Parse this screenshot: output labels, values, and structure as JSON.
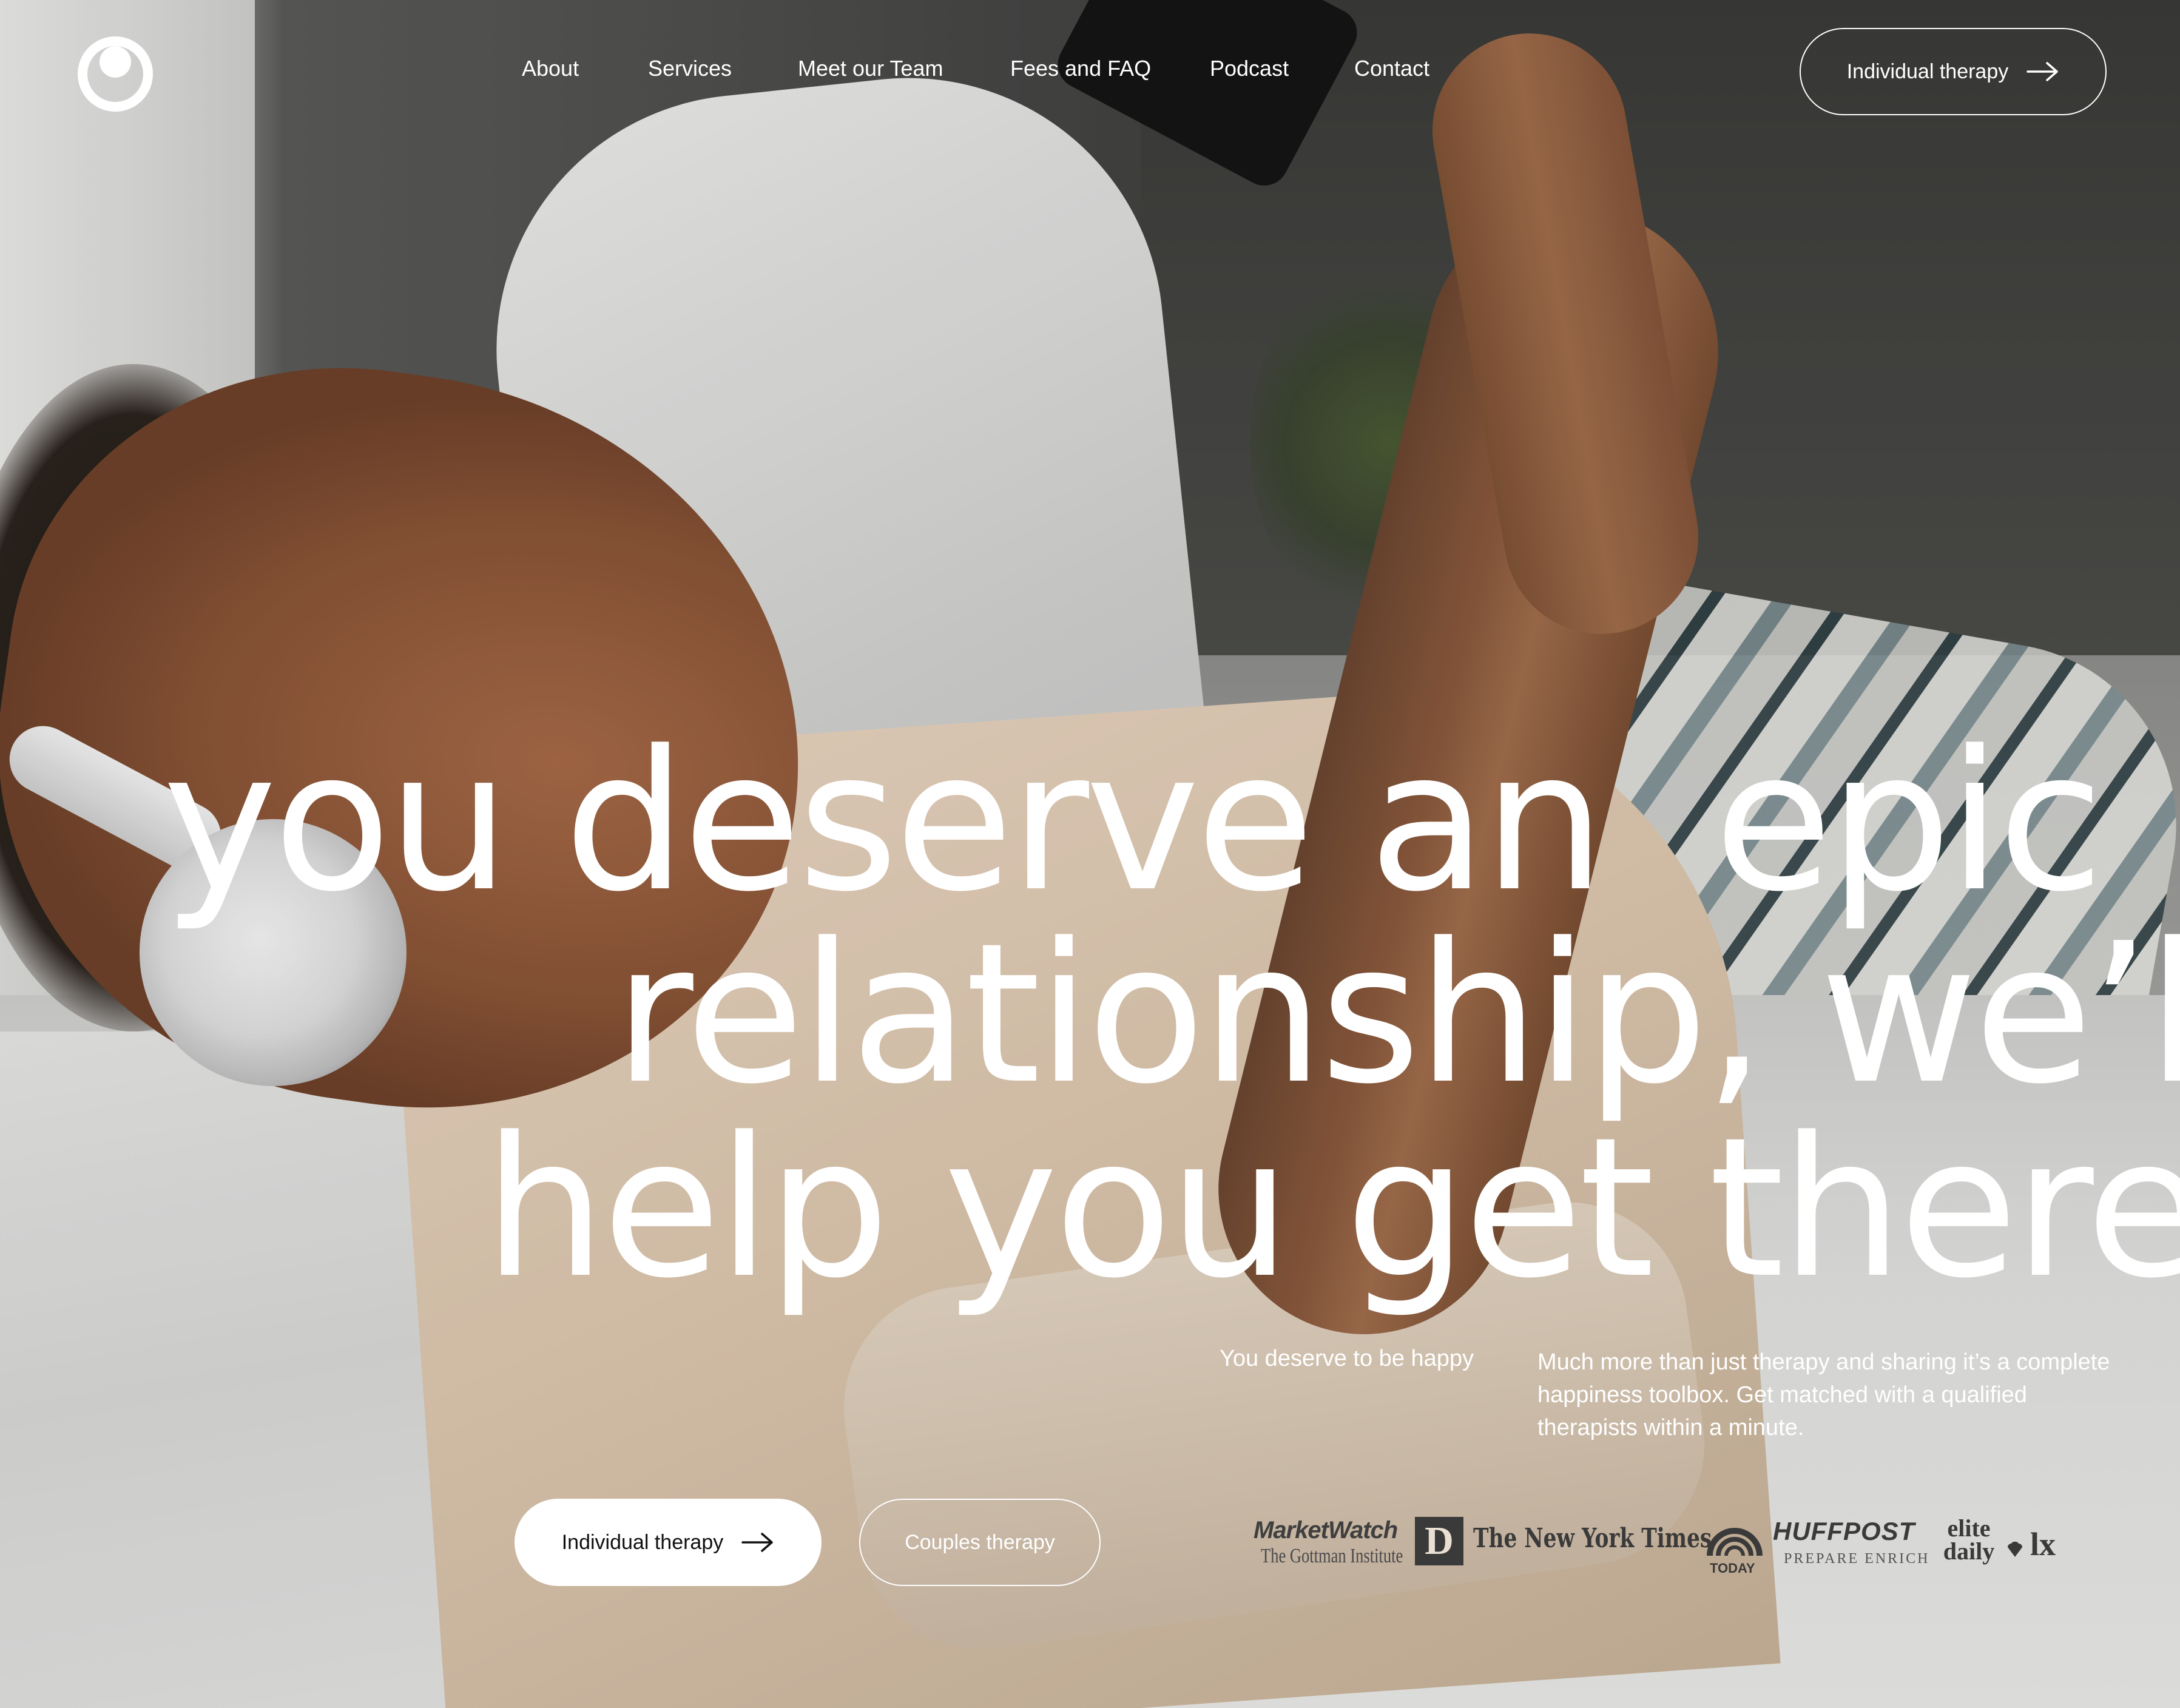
{
  "nav": {
    "items": [
      "About",
      "Services",
      "Meet our Team",
      "Fees and FAQ",
      "Podcast",
      "Contact"
    ],
    "cta_label": "Individual therapy"
  },
  "hero": {
    "headline": {
      "line1_a": "you deserve an",
      "line1_b": "epic",
      "line2": "relationship, we’ll",
      "line3": "help you get there."
    },
    "tagline": "You deserve to be happy",
    "description": "Much more than just therapy and sharing it’s a complete happiness toolbox. Get matched with a qualified therapists within a minute.",
    "primary_cta": "Individual therapy",
    "secondary_cta": "Couples therapy"
  },
  "press_logos": [
    {
      "name": "MarketWatch",
      "icon": "marketwatch-logo"
    },
    {
      "name": "The Gottman Institute",
      "icon": "gottman-logo"
    },
    {
      "name": "D",
      "icon": "d-magazine-logo"
    },
    {
      "name": "The New York Times",
      "icon": "nyt-logo"
    },
    {
      "name": "TODAY",
      "icon": "today-logo"
    },
    {
      "name": "HUFFPOST",
      "icon": "huffpost-logo"
    },
    {
      "name": "PREPARE ENRICH",
      "icon": "prepare-enrich-logo"
    },
    {
      "name": "elite daily",
      "icon": "elite-daily-logo"
    },
    {
      "name": "lx",
      "icon": "lx-logo"
    }
  ],
  "icons": [
    "logo-icon",
    "arrow-right-icon"
  ],
  "colors": {
    "text": "#ffffff",
    "button_bg": "#ffffff",
    "button_text": "#111111",
    "logo_tint": "#3a3a3a"
  }
}
